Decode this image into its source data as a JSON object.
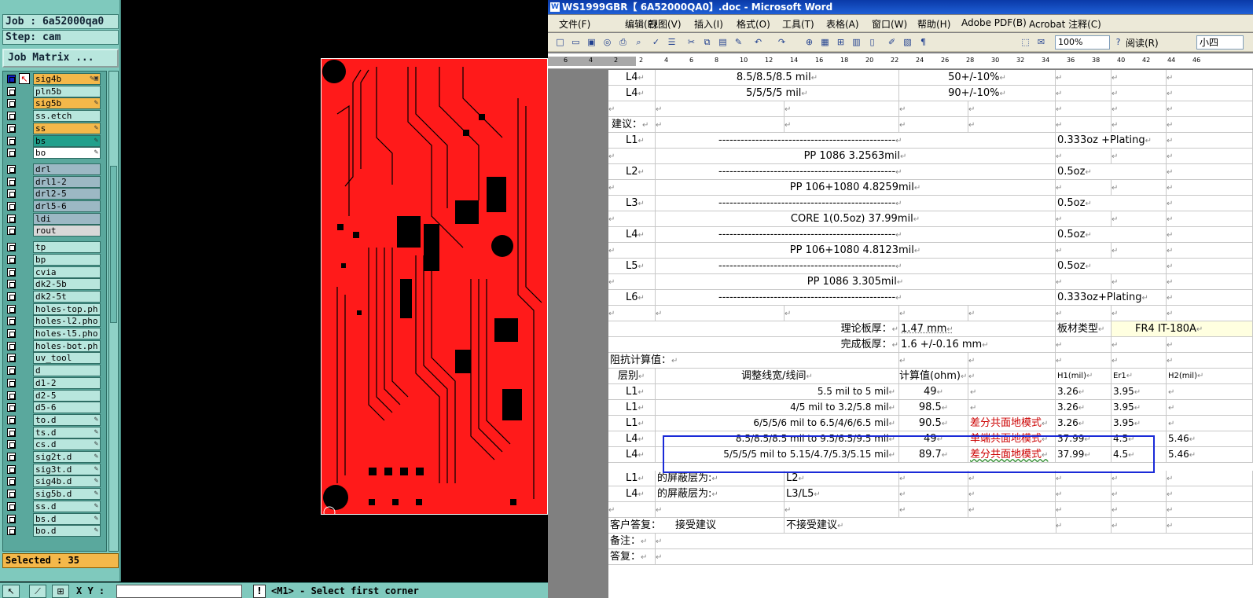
{
  "cam": {
    "job_label": "Job : 6a52000qa0",
    "step_label": "Step: cam",
    "job_matrix_button": "Job Matrix ...",
    "selected_label": "Selected : 35",
    "xy_label": "X Y :",
    "message": "<M1> - Select first corner",
    "layers": [
      {
        "name": "sig4b",
        "color": "#f4b84a",
        "mark": "✎▣",
        "active": true
      },
      {
        "name": "pln5b",
        "color": "#b8e6dd",
        "mark": ""
      },
      {
        "name": "sig5b",
        "color": "#f4b84a",
        "mark": "✎"
      },
      {
        "name": "ss.etch",
        "color": "#b8e6dd",
        "mark": ""
      },
      {
        "name": "ss",
        "color": "#f4b84a",
        "mark": "✎"
      },
      {
        "name": "bs",
        "color": "#21a08c",
        "mark": "✎"
      },
      {
        "name": "bo",
        "color": "#ffffff",
        "mark": "✎"
      },
      {
        "name": "drl",
        "color": "#9cb8c4",
        "mark": ""
      },
      {
        "name": "drl1-2",
        "color": "#9cb8c4",
        "mark": ""
      },
      {
        "name": "drl2-5",
        "color": "#9cb8c4",
        "mark": ""
      },
      {
        "name": "drl5-6",
        "color": "#9cb8c4",
        "mark": ""
      },
      {
        "name": "ldi",
        "color": "#9cb8c4",
        "mark": ""
      },
      {
        "name": "rout",
        "color": "#d8d8d8",
        "mark": ""
      },
      {
        "name": "tp",
        "color": "#b8e6dd",
        "mark": ""
      },
      {
        "name": "bp",
        "color": "#b8e6dd",
        "mark": ""
      },
      {
        "name": "cvia",
        "color": "#b8e6dd",
        "mark": ""
      },
      {
        "name": "dk2-5b",
        "color": "#b8e6dd",
        "mark": ""
      },
      {
        "name": "dk2-5t",
        "color": "#b8e6dd",
        "mark": ""
      },
      {
        "name": "holes-top.ph",
        "color": "#b8e6dd",
        "mark": ""
      },
      {
        "name": "holes-l2.pho",
        "color": "#b8e6dd",
        "mark": ""
      },
      {
        "name": "holes-l5.pho",
        "color": "#b8e6dd",
        "mark": ""
      },
      {
        "name": "holes-bot.ph",
        "color": "#b8e6dd",
        "mark": ""
      },
      {
        "name": "uv_tool",
        "color": "#b8e6dd",
        "mark": ""
      },
      {
        "name": "d",
        "color": "#b8e6dd",
        "mark": ""
      },
      {
        "name": "d1-2",
        "color": "#b8e6dd",
        "mark": ""
      },
      {
        "name": "d2-5",
        "color": "#b8e6dd",
        "mark": ""
      },
      {
        "name": "d5-6",
        "color": "#b8e6dd",
        "mark": ""
      },
      {
        "name": "to.d",
        "color": "#b8e6dd",
        "mark": "✎"
      },
      {
        "name": "ts.d",
        "color": "#b8e6dd",
        "mark": "✎"
      },
      {
        "name": "cs.d",
        "color": "#b8e6dd",
        "mark": "✎"
      },
      {
        "name": "sig2t.d",
        "color": "#b8e6dd",
        "mark": "✎"
      },
      {
        "name": "sig3t.d",
        "color": "#b8e6dd",
        "mark": "✎"
      },
      {
        "name": "sig4b.d",
        "color": "#b8e6dd",
        "mark": "✎"
      },
      {
        "name": "sig5b.d",
        "color": "#b8e6dd",
        "mark": "✎"
      },
      {
        "name": "ss.d",
        "color": "#b8e6dd",
        "mark": "✎"
      },
      {
        "name": "bs.d",
        "color": "#b8e6dd",
        "mark": "✎"
      },
      {
        "name": "bo.d",
        "color": "#b8e6dd",
        "mark": "✎"
      }
    ]
  },
  "word": {
    "title": "WS1999GBR【 6A52000QA0】.doc - Microsoft Word",
    "menu": [
      "文件(F)",
      "编辑(E)",
      "视图(V)",
      "插入(I)",
      "格式(O)",
      "工具(T)",
      "表格(A)",
      "窗口(W)",
      "帮助(H)",
      "Adobe PDF(B)",
      "Acrobat 注释(C)"
    ],
    "zoom": "100%",
    "read_button": "阅读(R)",
    "font_size": "小四",
    "ruler_numbers": [
      "6",
      "4",
      "2",
      "2",
      "4",
      "6",
      "8",
      "10",
      "12",
      "14",
      "16",
      "18",
      "20",
      "22",
      "24",
      "26",
      "28",
      "30",
      "32",
      "34",
      "36",
      "38",
      "40",
      "42",
      "44",
      "46"
    ],
    "top_rows": [
      {
        "layer": "L4",
        "spec": "8.5/8.5/8.5 mil",
        "tol": "50+/-10%"
      },
      {
        "layer": "L4",
        "spec": "5/5/5/5 mil",
        "tol": "90+/-10%"
      }
    ],
    "advice_label": "建议：",
    "stack": [
      {
        "layer": "L1",
        "copper": "0.333oz +Plating",
        "pp": "PP  1086  3.2563mil"
      },
      {
        "layer": "L2",
        "copper": "0.5oz",
        "pp": "PP  106+1080  4.8259mil"
      },
      {
        "layer": "L3",
        "copper": "0.5oz",
        "pp": "CORE  1(0.5oz)  37.99mil"
      },
      {
        "layer": "L4",
        "copper": "0.5oz",
        "pp": "PP  106+1080  4.8123mil"
      },
      {
        "layer": "L5",
        "copper": "0.5oz",
        "pp": "PP  1086  3.305mil"
      },
      {
        "layer": "L6",
        "copper": "0.333oz+Plating",
        "pp": ""
      }
    ],
    "dashes": "------------------------------------------------",
    "theory_thickness_label": "理论板厚：",
    "theory_thickness_value": "1.47 mm",
    "material_label": "板材类型",
    "material_value": "FR4 IT-180A",
    "finish_thickness_label": "完成板厚：",
    "finish_thickness_value": "1.6 +/-0.16 mm",
    "impedance_title": "阻抗计算值：",
    "headers": {
      "layer": "层别",
      "adjust": "调整线宽/线间",
      "calc": "计算值(ohm)",
      "h1": "H1(mil)",
      "er1": "Er1",
      "h2": "H2(mil)"
    },
    "imp_rows": [
      {
        "layer": "L1",
        "adjust": "5.5  mil to  5 mil",
        "calc": "49",
        "mode": "",
        "h1": "3.26",
        "er1": "3.95",
        "h2": ""
      },
      {
        "layer": "L1",
        "adjust": "4/5  mil to  3.2/5.8 mil",
        "calc": "98.5",
        "mode": "",
        "h1": "3.26",
        "er1": "3.95",
        "h2": ""
      },
      {
        "layer": "L1",
        "adjust": "6/5/5/6  mil to  6.5/4/6/6.5 mil",
        "calc": "90.5",
        "mode": "差分共面地模式",
        "h1": "3.26",
        "er1": "3.95",
        "h2": ""
      },
      {
        "layer": "L4",
        "adjust": "8.5/8.5/8.5  mil to  9.5/6.5/9.5 mil",
        "calc": "49",
        "mode": "单端共面地模式",
        "h1": "37.99",
        "er1": "4.5",
        "h2": "5.46"
      },
      {
        "layer": "L4",
        "adjust": "5/5/5/5  mil to  5.15/4.7/5.3/5.15 mil",
        "calc": "89.7",
        "mode": "差分共面地模式",
        "h1": "37.99",
        "er1": "4.5",
        "h2": "5.46"
      }
    ],
    "shield_rows": [
      {
        "layer": "L1",
        "label": "的屏蔽层为:",
        "value": "L2"
      },
      {
        "layer": "L4",
        "label": "的屏蔽层为:",
        "value": "L3/L5"
      }
    ],
    "reply_label": "客户答复：",
    "accept": "接受建议",
    "reject": "不接受建议",
    "remark_label": "备注：",
    "answer_label": "答复："
  }
}
